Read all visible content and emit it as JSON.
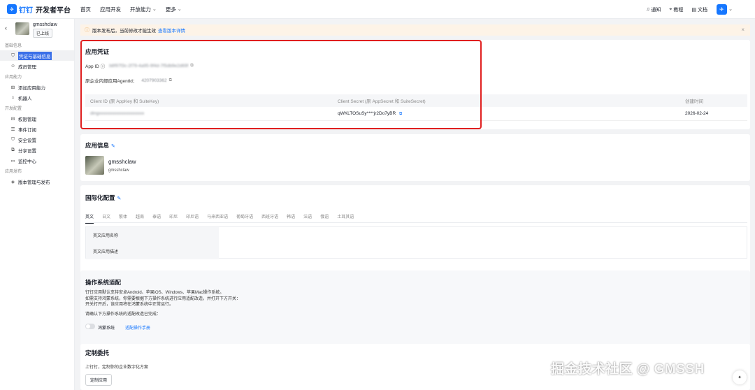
{
  "topbar": {
    "brand": "钉钉",
    "title": "开发者平台",
    "nav": [
      {
        "label": "首页",
        "has_menu": false
      },
      {
        "label": "应用开发",
        "has_menu": false
      },
      {
        "label": "开放能力",
        "has_menu": true
      },
      {
        "label": "更多",
        "has_menu": true
      }
    ],
    "right_links": [
      {
        "icon": "bell-icon",
        "label": "通知"
      },
      {
        "icon": "location-icon",
        "label": "教程"
      },
      {
        "icon": "document-icon",
        "label": "文档"
      }
    ]
  },
  "sidebar": {
    "app_name": "gmsshclaw",
    "app_status": "已上线",
    "sections": [
      {
        "title": "基础信息",
        "items": [
          {
            "label": "凭证与基础信息",
            "icon": "shield-icon",
            "active": true
          },
          {
            "label": "成员管理",
            "icon": "user-icon",
            "active": false
          }
        ]
      },
      {
        "title": "应用能力",
        "items": [
          {
            "label": "添加应用能力",
            "icon": "plus-square-icon",
            "active": false
          },
          {
            "label": "机器人",
            "icon": "robot-icon",
            "active": false
          }
        ]
      },
      {
        "title": "开发配置",
        "items": [
          {
            "label": "权限管理",
            "icon": "lock-icon",
            "active": false
          },
          {
            "label": "事件订阅",
            "icon": "list-icon",
            "active": false
          },
          {
            "label": "安全设置",
            "icon": "shield-check-icon",
            "active": false
          },
          {
            "label": "分享设置",
            "icon": "share-icon",
            "active": false
          },
          {
            "label": "监控中心",
            "icon": "monitor-icon",
            "active": false
          }
        ]
      },
      {
        "title": "应用发布",
        "items": [
          {
            "label": "版本管理与发布",
            "icon": "version-icon",
            "active": false
          }
        ]
      }
    ]
  },
  "notice": {
    "text": "版本发布后，当前修改才能生效",
    "link": "查看版本详情"
  },
  "credentials": {
    "title": "应用凭证",
    "app_id_label": "App ID",
    "app_id_value": "b8f97f3c-2f79-4a95-9f4d-7f5db9e2d69f",
    "agent_label": "原企业内部应用AgentId：",
    "agent_value": "4207903362",
    "table": {
      "headers": [
        "Client ID (原 AppKey 和 SuiteKey)",
        "Client Secret (原 AppSecret 和 SuiteSecret)",
        "创建时间"
      ],
      "row": {
        "client_id": "dingxxxxxxxxxxxxxxxxxxxx",
        "client_secret": "qWKLTOSuSy****jr2Do7yBR",
        "created": "2026-02-24"
      }
    }
  },
  "app_info": {
    "title": "应用信息",
    "name": "gmsshclaw",
    "desc": "gmsshclaw"
  },
  "i18n": {
    "title": "国际化配置",
    "tabs": [
      "英文",
      "日文",
      "繁体",
      "越南",
      "泰语",
      "印尼",
      "印尼语",
      "马来西亚语",
      "葡萄牙语",
      "西班牙语",
      "韩语",
      "法语",
      "俄语",
      "土耳其语"
    ],
    "active_tab": 0,
    "rows": [
      "英文应用名称",
      "英文应用描述"
    ]
  },
  "os": {
    "title": "操作系统适配",
    "lines": [
      "钉钉应用默认支持安卓Android、苹果iOS、Windows、苹果Mac操作系统。",
      "如需支持鸿蒙系统，你需要根据下方操作系统进行应用适配改造，并打开下方开关：",
      "开关打开后，该应用将在鸿蒙系统中正常运行。"
    ],
    "confirm": "请确认下方操作系统的适配改造已完成：",
    "toggle_label": "鸿蒙系统",
    "toggle_link": "适配操作手册"
  },
  "custom": {
    "title": "定制委托",
    "desc": "上钉钉，定制你的企业数字化方案",
    "button": "定制应用"
  },
  "watermark": "掘金技术社区 @ GMSSH"
}
